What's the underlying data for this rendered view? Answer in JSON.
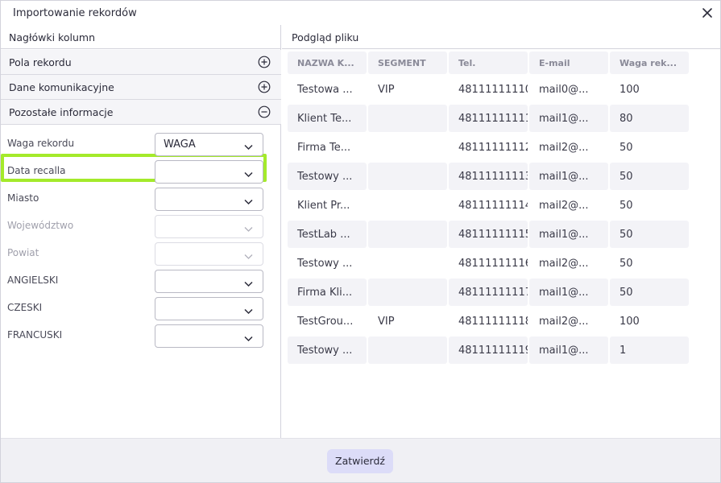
{
  "dialog": {
    "title": "Importowanie rekordów",
    "close_icon": "close-icon",
    "confirm_label": "Zatwierdź"
  },
  "left_panel": {
    "header": "Nagłówki kolumn",
    "sections": [
      {
        "label": "Pola rekordu",
        "icon": "plus-circle-icon"
      },
      {
        "label": "Dane komunikacyjne",
        "icon": "plus-circle-icon"
      },
      {
        "label": "Pozostałe informacje",
        "icon": "minus-circle-icon"
      }
    ],
    "fields": [
      {
        "label": "Waga rekordu",
        "value": "WAGA",
        "disabled": false,
        "highlighted": true
      },
      {
        "label": "Data recalla",
        "value": "",
        "disabled": false
      },
      {
        "label": "Miasto",
        "value": "",
        "disabled": false
      },
      {
        "label": "Województwo",
        "value": "",
        "disabled": true
      },
      {
        "label": "Powiat",
        "value": "",
        "disabled": true
      },
      {
        "label": "ANGIELSKI",
        "value": "",
        "disabled": false
      },
      {
        "label": "CZESKI",
        "value": "",
        "disabled": false
      },
      {
        "label": "FRANCUSKI",
        "value": "",
        "disabled": false
      }
    ]
  },
  "right_panel": {
    "header": "Podgląd pliku",
    "columns": [
      "NAZWA K...",
      "SEGMENT",
      "Tel.",
      "E-mail",
      "Waga rek..."
    ],
    "rows": [
      [
        "Testowa ...",
        "VIP",
        "48111111110",
        "mail0@...",
        "100"
      ],
      [
        "Klient Te...",
        "",
        "48111111111",
        "mail1@...",
        "80"
      ],
      [
        "Firma Te...",
        "",
        "48111111112",
        "mail2@...",
        "50"
      ],
      [
        "Testowy ...",
        "",
        "48111111113",
        "mail1@...",
        "50"
      ],
      [
        "Klient Pr...",
        "",
        "48111111114",
        "mail2@...",
        "50"
      ],
      [
        "TestLab ...",
        "",
        "48111111115",
        "mail1@...",
        "50"
      ],
      [
        "Testowy ...",
        "",
        "48111111116",
        "mail2@...",
        "50"
      ],
      [
        "Firma Kli...",
        "",
        "48111111117",
        "mail1@...",
        "50"
      ],
      [
        "TestGrou...",
        "VIP",
        "48111111118",
        "mail2@...",
        "100"
      ],
      [
        "Testowy ...",
        "",
        "48111111119",
        "mail1@...",
        "1"
      ]
    ]
  },
  "colors": {
    "highlight": "#a4ea2b",
    "confirm_bg": "#dcdcf8",
    "footer_bg": "#f0f0f4",
    "alt_row_bg": "#f3f3f7"
  }
}
